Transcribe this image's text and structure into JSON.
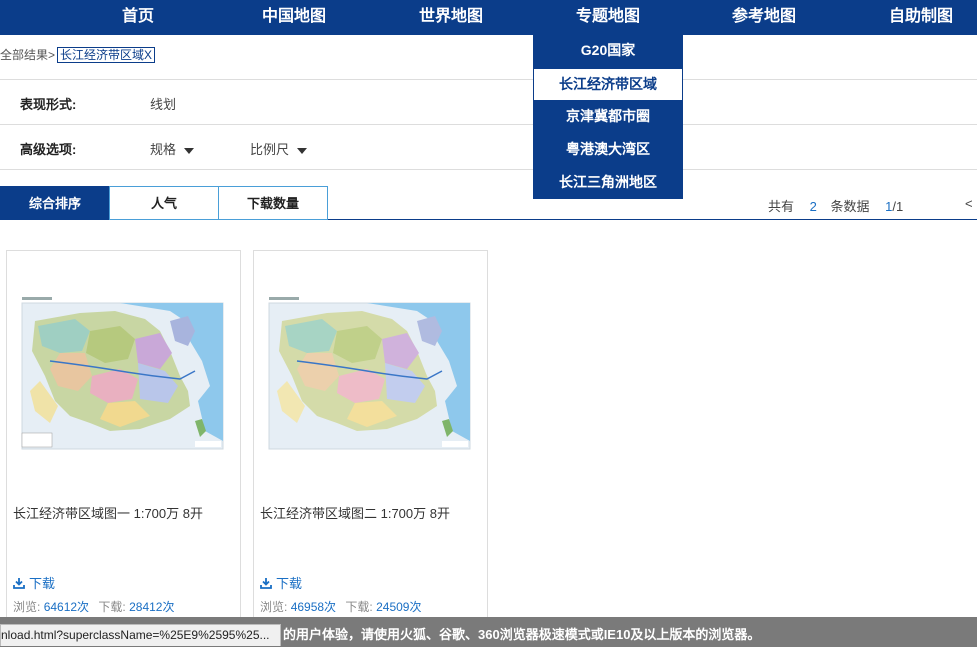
{
  "nav": {
    "items": [
      "首页",
      "中国地图",
      "世界地图",
      "专题地图",
      "参考地图",
      "自助制图"
    ]
  },
  "dropdown": {
    "items": [
      "G20国家",
      "长江经济带区域",
      "京津冀都市圈",
      "粤港澳大湾区",
      "长江三角洲地区"
    ],
    "active_index": 1
  },
  "breadcrumb": {
    "root": "全部结果>",
    "tag": "长江经济带区域X"
  },
  "filters": {
    "form_label": "表现形式:",
    "form_value": "线划",
    "advanced_label": "高级选项:",
    "spec_label": "规格",
    "scale_label": "比例尺"
  },
  "sort": {
    "tabs": [
      "综合排序",
      "人气",
      "下载数量"
    ],
    "active_index": 0
  },
  "pager": {
    "prefix": "共有",
    "total": "2",
    "suffix": "条数据",
    "current": "1",
    "pages": "/1",
    "prev": "<"
  },
  "cards": [
    {
      "title": "长江经济带区域图一 1:700万 8开",
      "download_label": "下载",
      "views_label": "浏览:",
      "views": "64612次",
      "downloads_label": "下载:",
      "downloads": "28412次"
    },
    {
      "title": "长江经济带区域图二 1:700万 8开",
      "download_label": "下载",
      "views_label": "浏览:",
      "views": "46958次",
      "downloads_label": "下载:",
      "downloads": "24509次"
    }
  ],
  "status": {
    "url": "nload.html?superclassName=%25E9%2595%25...",
    "notice": "的用户体验，请使用火狐、谷歌、360浏览器极速模式或IE10及以上版本的浏览器。"
  },
  "colors": {
    "brand": "#0b3d8a",
    "link": "#1a6fc4",
    "status_bg": "#7a7a7a"
  },
  "icons": {
    "download": "download-icon",
    "caret": "caret-down-icon"
  }
}
